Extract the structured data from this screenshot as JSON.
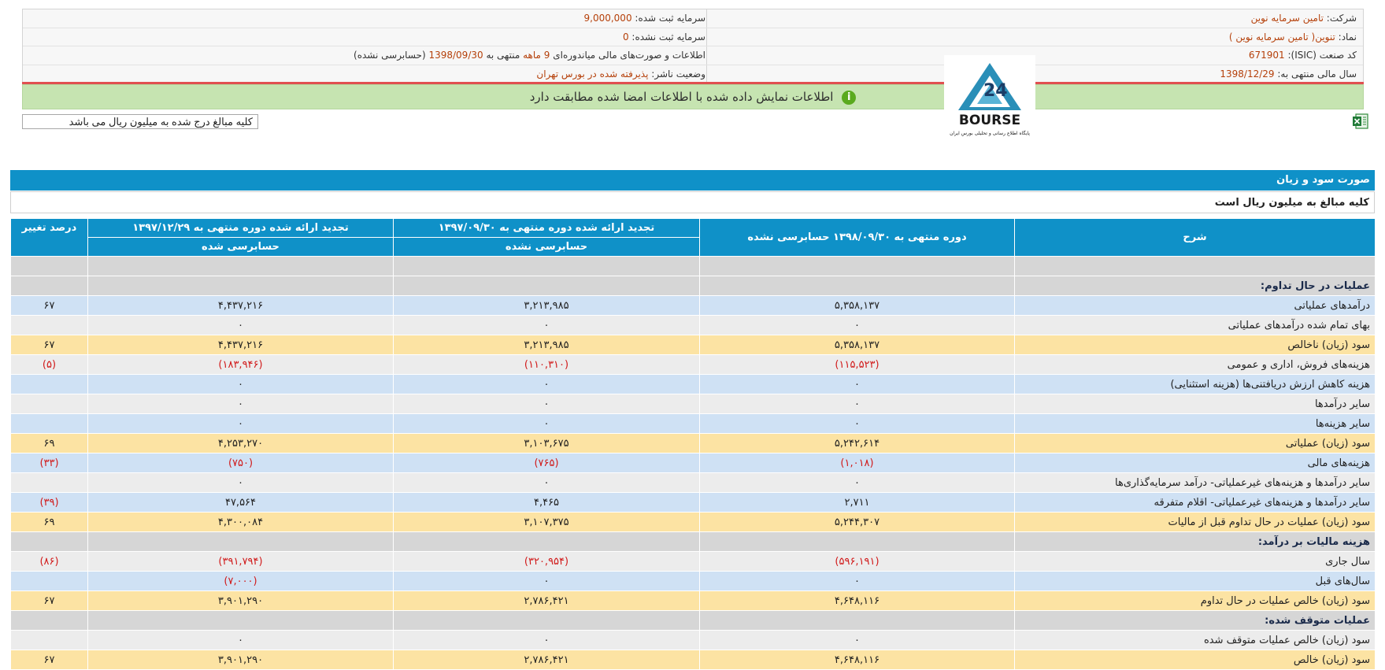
{
  "company_info": {
    "company_label": "شرکت:",
    "company_value": "تامین سرمایه نوین",
    "symbol_label": "نماد:",
    "symbol_value": "تنوین( تامین سرمایه نوین )",
    "isic_label": "کد صنعت (ISIC):",
    "isic_value": "671901",
    "fiscal_label": "سال مالی منتهی به:",
    "fiscal_value": "1398/12/29",
    "registered_capital_label": "سرمایه ثبت شده:",
    "registered_capital_value": "9,000,000",
    "unregistered_capital_label": "سرمایه ثبت نشده:",
    "unregistered_capital_value": "0",
    "report_prefix": "اطلاعات و صورت‌های مالی میاندوره‌ای",
    "report_period": "9 ماهه",
    "report_middle": "منتهی به",
    "report_date": "1398/09/30",
    "report_suffix": "(حسابرسی نشده)",
    "publisher_status_label": "وضعیت ناشر:",
    "publisher_status_value": "پذیرفته شده در بورس تهران"
  },
  "notice": "اطلاعات نمایش داده شده با اطلاعات امضا شده مطابقت دارد",
  "logo": {
    "text": "BOURSE",
    "number": "24",
    "caption": "پایگاه اطلاع رسانی و تحلیلی بورس ایران"
  },
  "unit_input_value": "کلیه مبالغ درج شده به میلیون ریال می باشد",
  "table": {
    "title": "صورت سود و زیان",
    "subtitle": "کلیه مبالغ به میلیون ریال است",
    "headers": {
      "desc": "شرح",
      "col1": "دوره منتهی به ۱۳۹۸/۰۹/۳۰ حسابرسی نشده",
      "col2": "تجدید ارائه شده دوره منتهی به ۱۳۹۷/۰۹/۳۰",
      "col2_sub": "حسابرسی نشده",
      "col3": "تجدید ارائه شده دوره منتهی به ۱۳۹۷/۱۲/۲۹",
      "col3_sub": "حسابرسی شده",
      "change": "درصد تغییر"
    },
    "rows": [
      {
        "type": "sec",
        "desc": "",
        "c1": "",
        "c2": "",
        "c3": "",
        "chg": ""
      },
      {
        "type": "sec",
        "desc": "عملیات در حال تداوم:",
        "c1": "",
        "c2": "",
        "c3": "",
        "chg": ""
      },
      {
        "type": "light",
        "desc": "درآمدهای عملیاتی",
        "c1": "۵,۳۵۸,۱۳۷",
        "c2": "۳,۲۱۳,۹۸۵",
        "c3": "۴,۴۳۷,۲۱۶",
        "chg": "۶۷"
      },
      {
        "type": "gray",
        "desc": "بهای تمام شده درآمدهای عملیاتی",
        "c1": "۰",
        "c2": "۰",
        "c3": "۰",
        "chg": ""
      },
      {
        "type": "yellow",
        "desc": "سود (زیان) ناخالص",
        "c1": "۵,۳۵۸,۱۳۷",
        "c2": "۳,۲۱۳,۹۸۵",
        "c3": "۴,۴۳۷,۲۱۶",
        "chg": "۶۷"
      },
      {
        "type": "gray",
        "desc": "هزینه‌های فروش، اداری و عمومی",
        "c1": "(۱۱۵,۵۲۳)",
        "c2": "(۱۱۰,۳۱۰)",
        "c3": "(۱۸۳,۹۴۶)",
        "chg": "(۵)"
      },
      {
        "type": "light",
        "desc": "هزینه کاهش ارزش دریافتنی‌ها (هزینه استثنایی)",
        "c1": "۰",
        "c2": "۰",
        "c3": "۰",
        "chg": ""
      },
      {
        "type": "gray",
        "desc": "سایر درآمدها",
        "c1": "۰",
        "c2": "۰",
        "c3": "۰",
        "chg": ""
      },
      {
        "type": "light",
        "desc": "سایر هزینه‌ها",
        "c1": "۰",
        "c2": "۰",
        "c3": "۰",
        "chg": ""
      },
      {
        "type": "yellow",
        "desc": "سود (زیان) عملیاتی",
        "c1": "۵,۲۴۲,۶۱۴",
        "c2": "۳,۱۰۳,۶۷۵",
        "c3": "۴,۲۵۳,۲۷۰",
        "chg": "۶۹"
      },
      {
        "type": "light",
        "desc": "هزینه‌های مالی",
        "c1": "(۱,۰۱۸)",
        "c2": "(۷۶۵)",
        "c3": "(۷۵۰)",
        "chg": "(۳۳)"
      },
      {
        "type": "gray",
        "desc": "سایر درآمدها و هزینه‌های غیرعملیاتی- درآمد سرمایه‌گذاری‌ها",
        "c1": "۰",
        "c2": "۰",
        "c3": "۰",
        "chg": ""
      },
      {
        "type": "light",
        "desc": "سایر درآمدها و هزینه‌های غیرعملیاتی- اقلام متفرقه",
        "c1": "۲,۷۱۱",
        "c2": "۴,۴۶۵",
        "c3": "۴۷,۵۶۴",
        "chg": "(۳۹)"
      },
      {
        "type": "yellow",
        "desc": "سود (زیان) عملیات در حال تداوم قبل از مالیات",
        "c1": "۵,۲۴۴,۳۰۷",
        "c2": "۳,۱۰۷,۳۷۵",
        "c3": "۴,۳۰۰,۰۸۴",
        "chg": "۶۹"
      },
      {
        "type": "sec",
        "desc": "هزینه مالیات بر درآمد:",
        "c1": "",
        "c2": "",
        "c3": "",
        "chg": ""
      },
      {
        "type": "gray",
        "desc": "سال جاری",
        "c1": "(۵۹۶,۱۹۱)",
        "c2": "(۳۲۰,۹۵۴)",
        "c3": "(۳۹۱,۷۹۴)",
        "chg": "(۸۶)"
      },
      {
        "type": "light",
        "desc": "سال‌های قبل",
        "c1": "۰",
        "c2": "۰",
        "c3": "(۷,۰۰۰)",
        "chg": ""
      },
      {
        "type": "yellow",
        "desc": "سود (زیان) خالص عملیات در حال تداوم",
        "c1": "۴,۶۴۸,۱۱۶",
        "c2": "۲,۷۸۶,۴۲۱",
        "c3": "۳,۹۰۱,۲۹۰",
        "chg": "۶۷"
      },
      {
        "type": "sec",
        "desc": "عملیات متوقف شده:",
        "c1": "",
        "c2": "",
        "c3": "",
        "chg": ""
      },
      {
        "type": "gray",
        "desc": "سود (زیان) خالص عملیات متوقف شده",
        "c1": "۰",
        "c2": "۰",
        "c3": "۰",
        "chg": ""
      },
      {
        "type": "yellow",
        "desc": "سود (زیان) خالص",
        "c1": "۴,۶۴۸,۱۱۶",
        "c2": "۲,۷۸۶,۴۲۱",
        "c3": "۳,۹۰۱,۲۹۰",
        "chg": "۶۷"
      }
    ]
  },
  "colors": {
    "header_blue": "#0f91c8",
    "row_light_blue": "#cfe1f4",
    "row_gray": "#ececec",
    "row_yellow": "#fce3a3",
    "row_section": "#d6d6d6",
    "notice_green": "#c6e4b1",
    "negative_red": "#d11a1a"
  }
}
